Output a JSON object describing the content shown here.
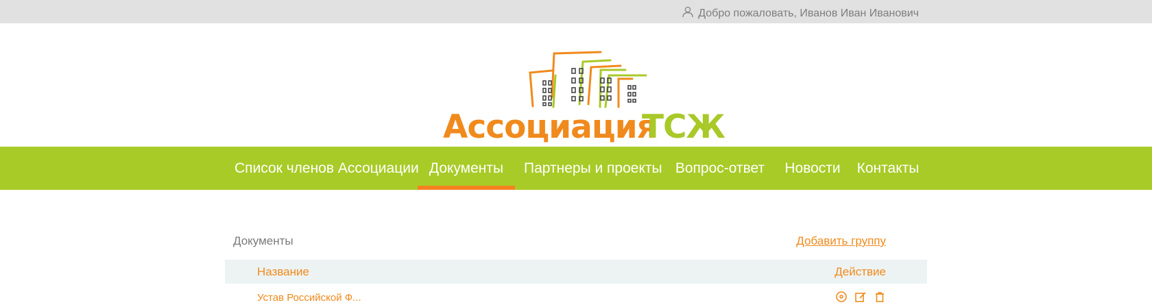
{
  "topbar": {
    "welcome_text": "Добро пожаловать, Иванов Иван Иванович",
    "icon": "user-icon"
  },
  "logo": {
    "word_orange": "Ассоциация",
    "word_green": "ТСЖ",
    "colors": {
      "orange": "#f08a1c",
      "green": "#a8c928"
    }
  },
  "nav": {
    "items": [
      {
        "label": "Список членов Ассоциации",
        "active": false
      },
      {
        "label": "Документы",
        "active": true
      },
      {
        "label": "Партнеры и проекты",
        "active": false
      },
      {
        "label": "Вопрос-ответ",
        "active": false
      },
      {
        "label": "Новости",
        "active": false
      },
      {
        "label": "Контакты",
        "active": false
      }
    ],
    "colors": {
      "background": "#a8cb27",
      "active_underline": "#f58220"
    }
  },
  "documents": {
    "title": "Документы",
    "add_group_label": "Добавить группу",
    "columns": {
      "name": "Название",
      "action": "Действие"
    },
    "rows": [
      {
        "name": "Устав Российской Ф...",
        "actions": [
          "view-icon",
          "edit-icon",
          "delete-icon"
        ]
      }
    ]
  }
}
